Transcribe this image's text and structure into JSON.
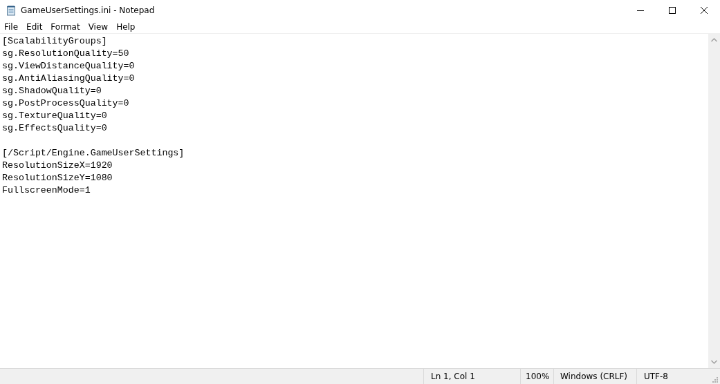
{
  "window": {
    "title": "GameUserSettings.ini - Notepad"
  },
  "menu": [
    "File",
    "Edit",
    "Format",
    "View",
    "Help"
  ],
  "editor": {
    "sections": [
      {
        "lines": [
          "[ScalabilityGroups]",
          "sg.ResolutionQuality=50",
          "sg.ViewDistanceQuality=0",
          "sg.AntiAliasingQuality=0",
          "sg.ShadowQuality=0",
          "sg.PostProcessQuality=0",
          "sg.TextureQuality=0",
          "sg.EffectsQuality=0"
        ]
      },
      {
        "lines": [
          "[/Script/Engine.GameUserSettings]",
          "ResolutionSizeX=1920",
          "ResolutionSizeY=1080",
          "FullscreenMode=1"
        ]
      }
    ]
  },
  "status_bar": {
    "position": "Ln 1, Col 1",
    "zoom": "100%",
    "line_ending": "Windows (CRLF)",
    "encoding": "UTF-8"
  }
}
